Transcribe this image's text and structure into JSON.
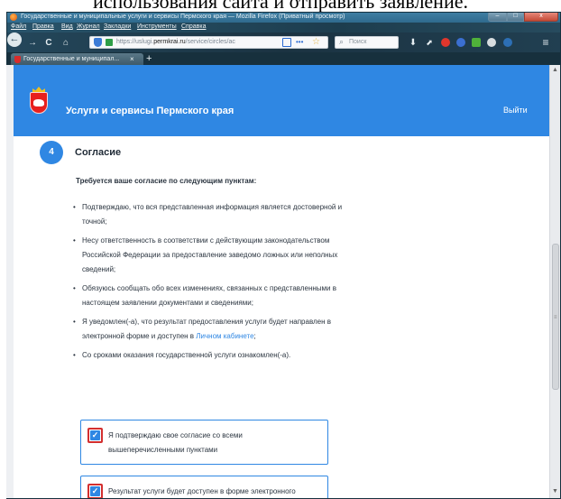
{
  "page_header_text": "использования сайта и отправить заявление.",
  "window": {
    "title": "Государственные и муниципальные услуги и сервисы Пермского края — Mozilla Firefox (Приватный просмотр)",
    "minimize_label": "–",
    "maximize_label": "□",
    "close_label": "x"
  },
  "menubar": {
    "items": [
      "Файл",
      "Правка",
      "Вид",
      "Журнал",
      "Закладки",
      "Инструменты",
      "Справка"
    ]
  },
  "toolbar": {
    "back_icon": "←",
    "forward_icon": "→",
    "reload_icon": "C",
    "home_icon": "⌂",
    "url_prefix": "https://uslugi.",
    "url_domain": "permkrai.ru",
    "url_rest": "/service/circles/ac",
    "more_label": "•••",
    "star_icon": "☆",
    "search_placeholder": "Поиск",
    "download_icon": "⬇",
    "abp_label": "ABP",
    "menu_icon": "≡"
  },
  "tab": {
    "label": "Государственные и муниципал...",
    "close": "×",
    "new_tab": "+"
  },
  "site": {
    "title": "Услуги и сервисы Пермского края",
    "logout": "Выйти"
  },
  "step": {
    "number": "4",
    "title": "Согласие"
  },
  "intro": "Требуется ваше согласие по следующим пунктам:",
  "bullets": [
    "Подтверждаю, что вся представленная информация является достоверной и точной;",
    "Несу ответственность в соответствии с действующим законодательством Российской Федерации за предоставление заведомо ложных или неполных сведений;",
    "Обязуюсь сообщать обо всех изменениях, связанных с представленными в настоящем заявлении документами и сведениями;"
  ],
  "bullet4": {
    "text": "Я уведомлен(-а), что результат предоставления услуги будет направлен в электронной форме и доступен в ",
    "link": "Личном кабинете",
    "after": ";"
  },
  "bullet5": "Со сроками оказания государственной услуги ознакомлен(-а).",
  "consents": [
    {
      "text": "Я подтверждаю свое согласие со всеми вышеперечисленными пунктами",
      "checked": true
    },
    {
      "text": "Результат услуги будет доступен в форме электронного документа, подписанного",
      "checked": true
    }
  ],
  "checkmark": "✓",
  "scrollbar": {
    "up": "▲",
    "down": "▼",
    "grip": "≡"
  }
}
